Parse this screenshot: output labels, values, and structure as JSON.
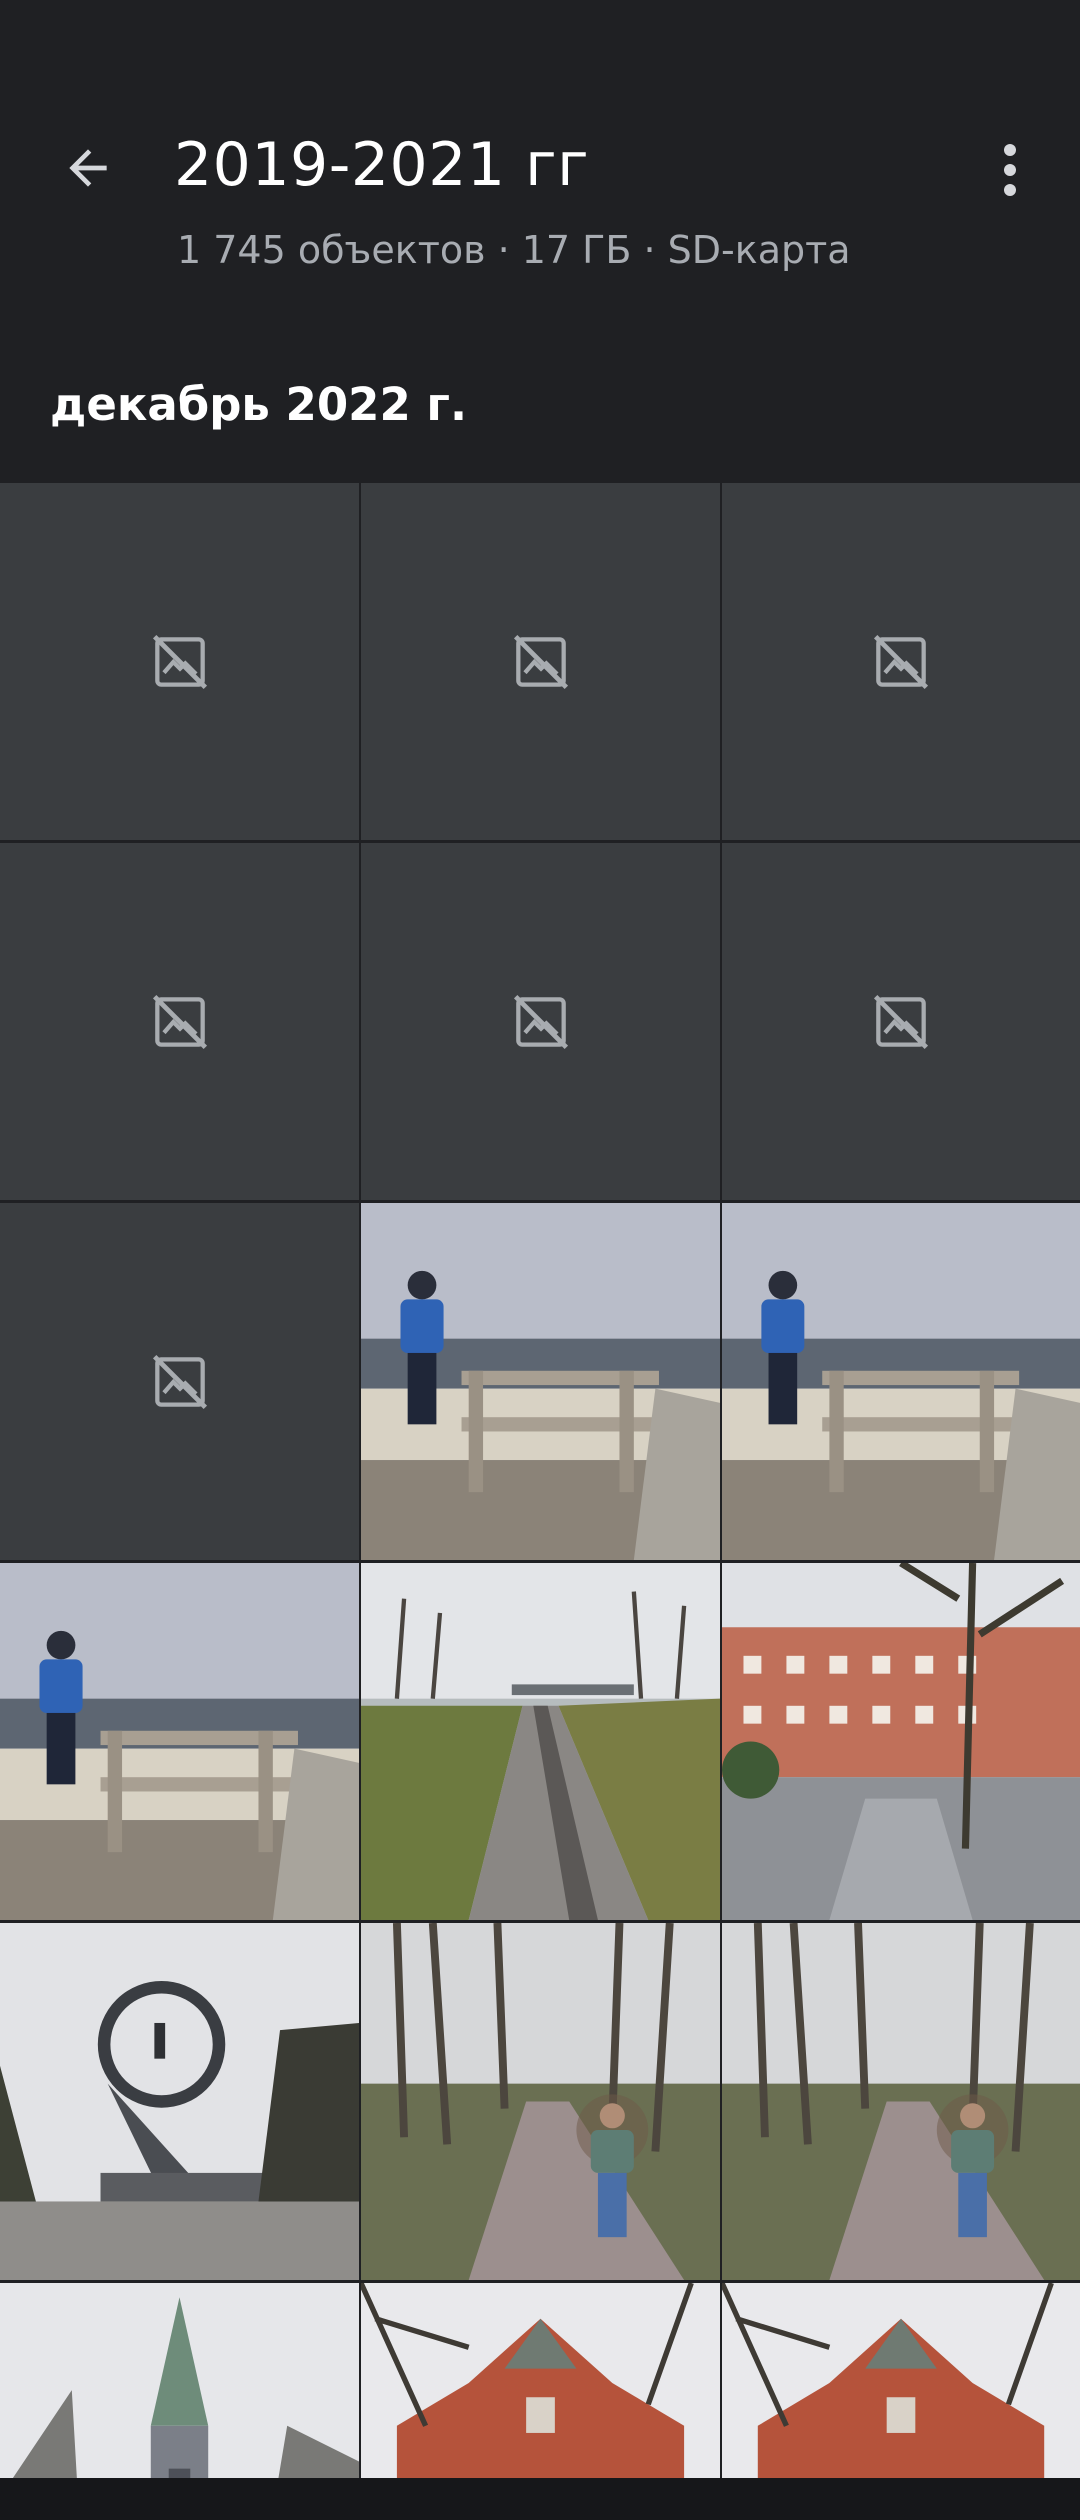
{
  "header": {
    "title": "2019-2021 гг",
    "subtitle": "1 745 объектов · 17 ГБ · SD-карта",
    "back_icon": "arrow-back-icon",
    "more_icon": "more-vert-icon"
  },
  "section": {
    "label": "декабрь 2022 г."
  },
  "grid": {
    "placeholder_icon": "broken-image-icon",
    "tiles": [
      {
        "kind": "placeholder"
      },
      {
        "kind": "placeholder"
      },
      {
        "kind": "placeholder"
      },
      {
        "kind": "placeholder"
      },
      {
        "kind": "placeholder"
      },
      {
        "kind": "placeholder"
      },
      {
        "kind": "placeholder"
      },
      {
        "kind": "photo",
        "scene": "man-on-pier-seaside"
      },
      {
        "kind": "photo",
        "scene": "man-on-pier-seaside"
      },
      {
        "kind": "photo",
        "scene": "man-on-pier-seaside"
      },
      {
        "kind": "photo",
        "scene": "railway-tracks"
      },
      {
        "kind": "photo",
        "scene": "brick-building-with-trees"
      },
      {
        "kind": "photo",
        "scene": "ring-monument"
      },
      {
        "kind": "photo",
        "scene": "man-on-park-path"
      },
      {
        "kind": "photo",
        "scene": "man-on-park-path"
      },
      {
        "kind": "photo",
        "scene": "church-spire"
      },
      {
        "kind": "photo",
        "scene": "red-brick-facade"
      },
      {
        "kind": "photo",
        "scene": "red-brick-facade"
      }
    ]
  },
  "colors": {
    "background": "#1f2023",
    "placeholder_tile": "#3a3d40",
    "title_text": "#ffffff",
    "subtitle_text": "#a8acb2"
  }
}
